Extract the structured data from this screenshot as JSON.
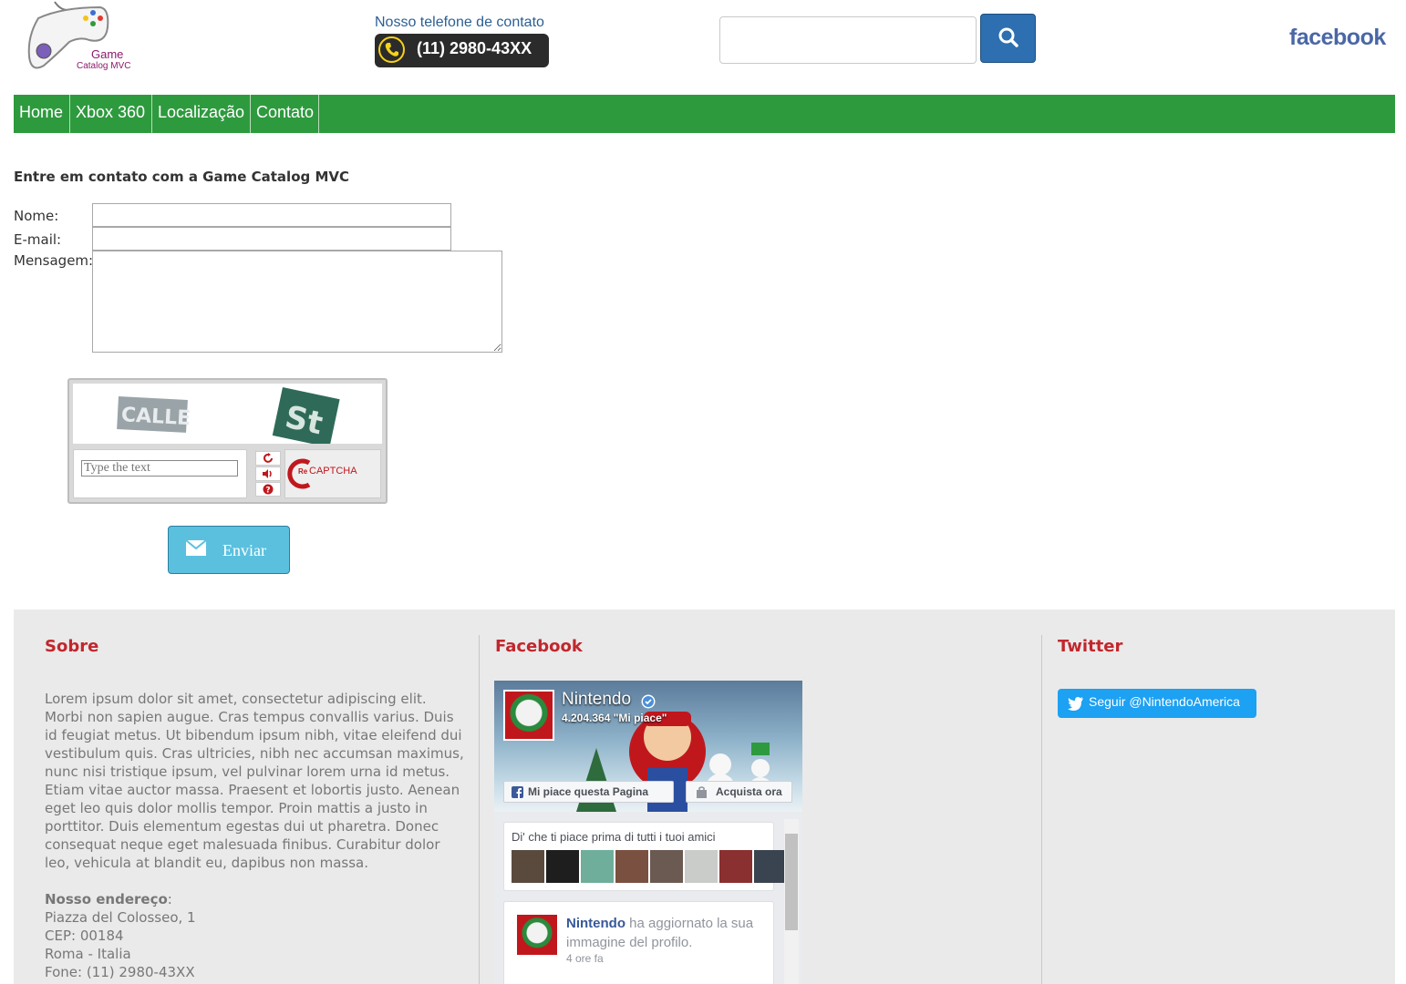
{
  "header": {
    "logo_line1": "Game",
    "logo_line2": "Catalog MVC",
    "phone_label": "Nosso telefone de contato",
    "phone_number": "(11) 2980-43XX",
    "search_placeholder": "",
    "facebook_brand": "facebook"
  },
  "nav": {
    "items": [
      "Home",
      "Xbox 360",
      "Localização",
      "Contato"
    ]
  },
  "form": {
    "title": "Entre em contato com a Game Catalog MVC",
    "name_label": "Nome:",
    "email_label": "E-mail:",
    "message_label": "Mensagem:",
    "name_value": "",
    "email_value": "",
    "message_value": "",
    "captcha_word1": "CALLE",
    "captcha_word2": "St",
    "captcha_placeholder": "Type the text",
    "captcha_brand": "CAPTCHA",
    "captcha_brand_prefix": "Re",
    "send_label": "Enviar"
  },
  "footer": {
    "about_title": "Sobre",
    "about_text": "Lorem ipsum dolor sit amet, consectetur adipiscing elit. Morbi non sapien augue. Cras tempus convallis varius. Duis id feugiat metus. Ut bibendum ipsum nibh, vitae eleifend dui vestibulum quis. Cras ultricies, nibh nec accumsan maximus, nunc nisi tristique ipsum, vel pulvinar lorem urna id metus. Etiam vitae auctor massa. Praesent et lobortis justo. Aenean eget leo quis dolor mollis tempor. Proin mattis a justo in porttitor. Duis elementum egestas dui ut pharetra. Donec consequat neque eget malesuada finibus. Curabitur dolor leo, vehicula at blandit eu, dapibus non massa.",
    "address_title": "Nosso endereço",
    "address_colon": ":",
    "address_lines": [
      "Piazza del Colosseo, 1",
      "CEP: 00184",
      "Roma - Italia",
      "Fone: (11) 2980-43XX"
    ],
    "facebook_title": "Facebook",
    "twitter_title": "Twitter",
    "fb_widget": {
      "page_name": "Nintendo",
      "likes": "4.204.364 \"Mi piace\"",
      "like_button": "Mi piace questa Pagina",
      "shop_button": "Acquista ora",
      "friends_text": "Di' che ti piace prima di tutti i tuoi amici",
      "post_author": "Nintendo",
      "post_text": "ha aggiornato la sua immagine del profilo.",
      "post_time": "4 ore fa"
    },
    "twitter_button": "Seguir @NintendoAmerica"
  },
  "colors": {
    "nav_green": "#2e9a3e",
    "search_blue": "#2d6fb0",
    "send_blue": "#5bc0de",
    "footer_heading_red": "#c1272d",
    "twitter_blue": "#1da1f2"
  },
  "icons": [
    "gamepad-logo-icon",
    "phone-icon",
    "search-icon",
    "envelope-icon",
    "refresh-icon",
    "audio-icon",
    "help-icon",
    "recaptcha-icon",
    "verified-badge-icon",
    "facebook-f-icon",
    "shopping-bag-icon",
    "twitter-bird-icon"
  ]
}
